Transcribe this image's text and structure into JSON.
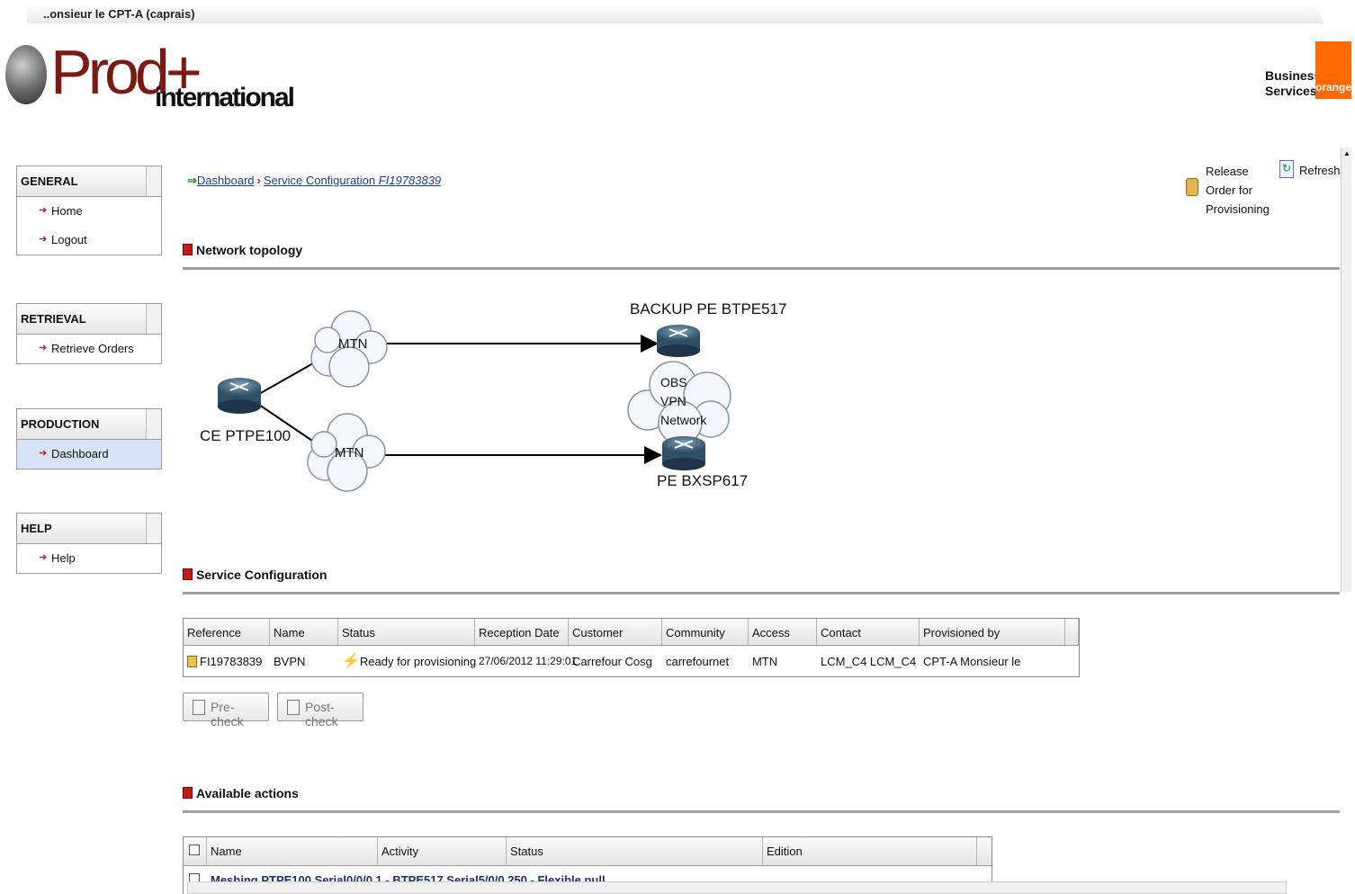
{
  "window": {
    "title": "..onsieur le CPT-A (caprais)"
  },
  "header": {
    "logo_main": "Prod+",
    "logo_sub": "international",
    "brand_line1": "Business",
    "brand_line2": "Services",
    "brand_badge": "orange"
  },
  "sidebar": {
    "general": {
      "title": "GENERAL",
      "items": [
        "Home",
        "Logout"
      ]
    },
    "retrieval": {
      "title": "RETRIEVAL",
      "items": [
        "Retrieve Orders"
      ]
    },
    "production": {
      "title": "PRODUCTION",
      "items": [
        "Dashboard"
      ]
    },
    "help": {
      "title": "HELP",
      "items": [
        "Help"
      ]
    }
  },
  "breadcrumb": {
    "item1": "Dashboard",
    "item2_prefix": "Service Configuration ",
    "item2_ref": "FI19783839"
  },
  "actions": {
    "release_l1": "Release",
    "release_l2": "Order for",
    "release_l3": "Provisioning",
    "refresh": "Refresh"
  },
  "sections": {
    "topology": "Network topology",
    "service": "Service Configuration",
    "available": "Available actions"
  },
  "topology": {
    "ce": "CE PTPE100",
    "backup_pe": "BACKUP PE BTPE517",
    "pe": "PE BXSP617",
    "cloud_top": "MTN",
    "cloud_bottom": "MTN",
    "obs_1": "OBS",
    "obs_2": "VPN",
    "obs_3": "Network"
  },
  "service_table": {
    "headers": [
      "Reference",
      "Name",
      "Status",
      "Reception Date",
      "Customer",
      "Community",
      "Access",
      "Contact",
      "Provisioned by"
    ],
    "row": [
      "FI19783839",
      "BVPN",
      "Ready for provisioning",
      "27/06/2012 11:29:01",
      "Carrefour Cosg",
      "carrefournet",
      "MTN",
      "LCM_C4 LCM_C4",
      "CPT-A Monsieur le"
    ]
  },
  "buttons": {
    "precheck": "Pre-check",
    "postcheck": "Post-check"
  },
  "actions_table": {
    "headers": [
      "Name",
      "Activity",
      "Status",
      "Edition"
    ],
    "partial_row": "Meshing PTPE100 Serial0/0/0.1 - BTPE517 Serial5/0/0.250 - Flexible.null"
  }
}
